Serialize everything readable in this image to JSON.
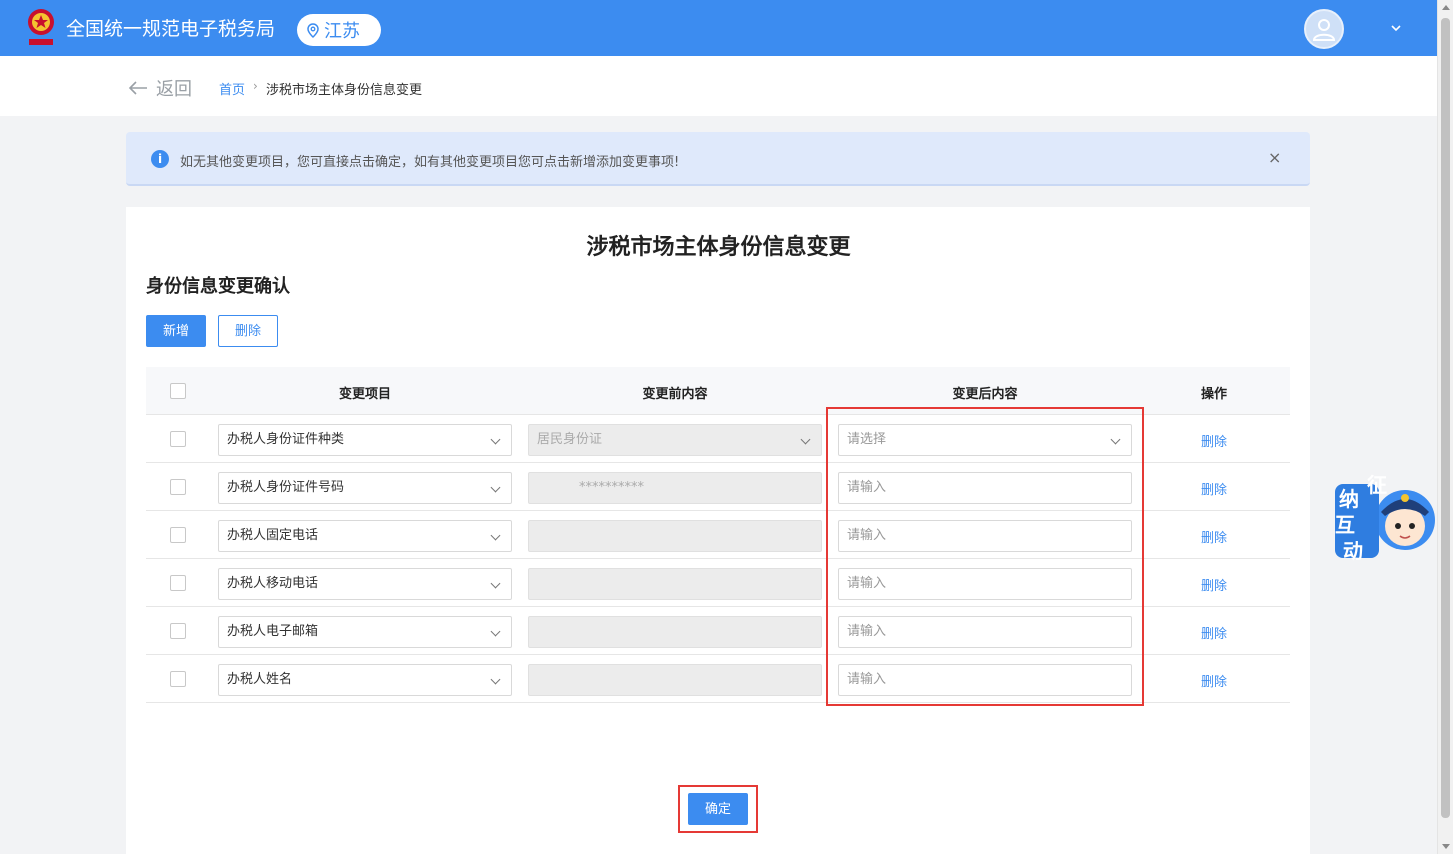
{
  "header": {
    "site_title": "全国统一规范电子税务局",
    "region": "江苏",
    "colors": {
      "brand": "#3c8cf0",
      "highlight": "#e53935"
    }
  },
  "breadcrumb": {
    "back_label": "返回",
    "home": "首页",
    "separator": "›",
    "current": "涉税市场主体身份信息变更"
  },
  "alert": {
    "icon": "i",
    "text": "如无其他变更项目，您可直接点击确定，如有其他变更项目您可点击新增添加变更事项!",
    "close": "×"
  },
  "main": {
    "page_title": "涉税市场主体身份信息变更",
    "section_title": "身份信息变更确认",
    "add_button": "新增",
    "delete_button": "删除",
    "table": {
      "headers": [
        "变更项目",
        "变更前内容",
        "变更后内容",
        "操作"
      ],
      "rows": [
        {
          "item": "办税人身份证件种类",
          "before": "居民身份证",
          "after_placeholder": "请选择",
          "action": "删除"
        },
        {
          "item": "办税人身份证件号码",
          "before": "**********",
          "after_placeholder": "请输入",
          "action": "删除"
        },
        {
          "item": "办税人固定电话",
          "before": "",
          "after_placeholder": "请输入",
          "action": "删除"
        },
        {
          "item": "办税人移动电话",
          "before": "",
          "after_placeholder": "请输入",
          "action": "删除"
        },
        {
          "item": "办税人电子邮箱",
          "before": "",
          "after_placeholder": "请输入",
          "action": "删除"
        },
        {
          "item": "办税人姓名",
          "before": "",
          "after_placeholder": "请输入",
          "action": "删除"
        }
      ]
    },
    "confirm_button": "确定"
  },
  "float_widget": {
    "text": [
      "征",
      "纳",
      "互",
      "动"
    ]
  }
}
